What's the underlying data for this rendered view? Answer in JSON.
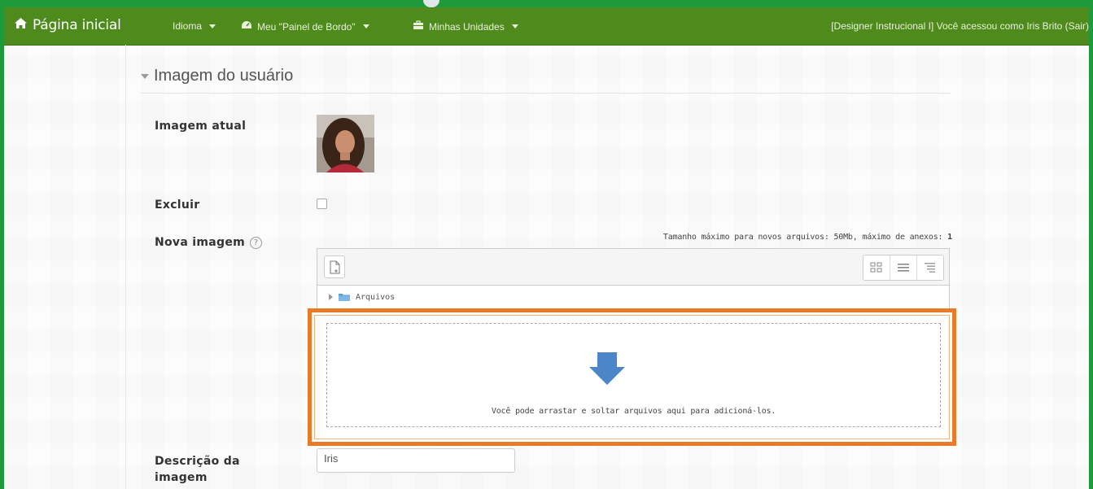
{
  "navbar": {
    "brand": "Página inicial",
    "language": "Idioma",
    "dashboard": "Meu \"Painel de Bordo\"",
    "units": "Minhas Unidades",
    "user_info": "[Designer Instrucional I] Você acessou como Iris Brito (Sair)"
  },
  "section": {
    "title": "Imagem do usuário"
  },
  "form": {
    "current_image_label": "Imagem atual",
    "delete_label": "Excluir",
    "new_image_label": "Nova imagem",
    "max_size_text": "Tamanho máximo para novos arquivos: 50Mb, máximo de anexos:",
    "max_attachments": "1",
    "files_folder": "Arquivos",
    "drop_text": "Você pode arrastar e soltar arquivos aqui para adicioná-los.",
    "image_description_label": "Descrição da imagem",
    "image_description_value": "Iris"
  },
  "colors": {
    "frame_green": "#1f9a3a",
    "navbar_green": "#4e8a1c",
    "highlight_orange": "#e87b2a",
    "drop_arrow_blue": "#4a86c8"
  },
  "icons": {
    "brand": "home-icon",
    "dashboard": "dashboard-icon",
    "units": "briefcase-icon",
    "add_file": "add-file-icon",
    "views": [
      "grid-view-icon",
      "list-view-icon",
      "tree-view-icon"
    ],
    "folder": "folder-icon",
    "drop": "down-arrow-icon",
    "help": "help-icon"
  }
}
